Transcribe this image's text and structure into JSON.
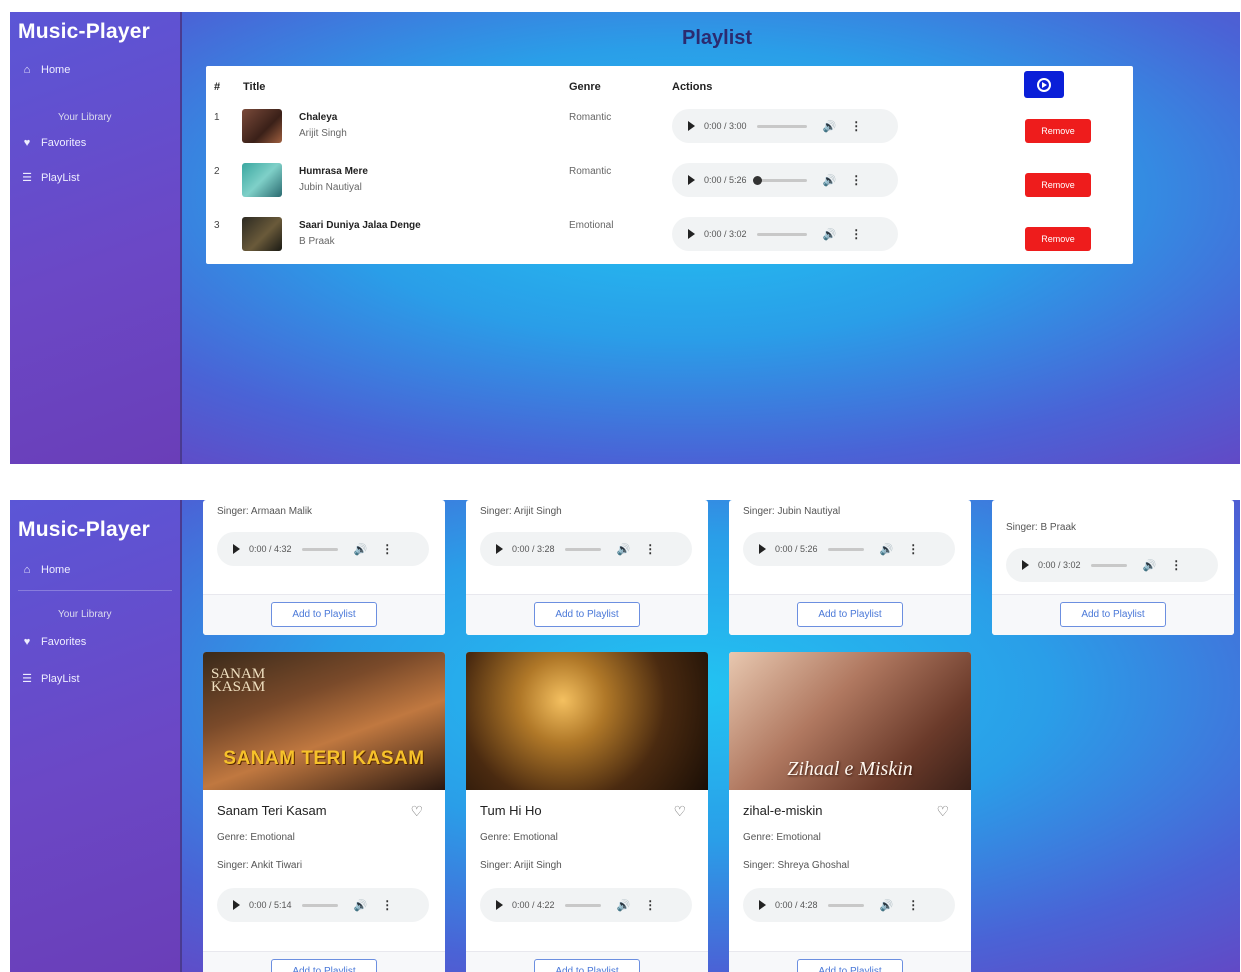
{
  "app": {
    "brand": "Music-Player",
    "nav_home": "Home",
    "library_heading": "Your Library",
    "nav_favorites": "Favorites",
    "nav_playlist": "PlayList"
  },
  "playlist": {
    "title": "Playlist",
    "columns": {
      "num": "#",
      "title": "Title",
      "genre": "Genre",
      "actions": "Actions"
    },
    "remove_label": "Remove",
    "rows": [
      {
        "num": "1",
        "song": "Chaleya",
        "artist": "Arijit Singh",
        "genre": "Romantic",
        "time": "0:00 / 3:00",
        "progress": 0.0
      },
      {
        "num": "2",
        "song": "Humrasa Mere",
        "artist": "Jubin Nautiyal",
        "genre": "Romantic",
        "time": "0:00 / 5:26",
        "progress": 0.0
      },
      {
        "num": "3",
        "song": "Saari Duniya Jalaa Denge",
        "artist": "B Praak",
        "genre": "Emotional",
        "time": "0:00 / 3:02",
        "progress": 0.0
      }
    ]
  },
  "browse": {
    "add_label": "Add to Playlist",
    "top_cards": [
      {
        "singer": "Singer: Armaan Malik",
        "time": "0:00 / 4:32"
      },
      {
        "singer": "Singer: Arijit Singh",
        "time": "0:00 / 3:28"
      },
      {
        "singer": "Singer: Jubin Nautiyal",
        "time": "0:00 / 5:26"
      },
      {
        "singer": "Singer: B Praak",
        "time": "0:00 / 3:02"
      }
    ],
    "cards": [
      {
        "title": "Sanam Teri Kasam",
        "genre": "Genre: Emotional",
        "singer": "Singer: Ankit Tiwari",
        "time": "0:00 / 5:14",
        "cover_text": "SANAM TERI KASAM",
        "cover_text_top": "SANAM KASAM"
      },
      {
        "title": "Tum Hi Ho",
        "genre": "Genre: Emotional",
        "singer": "Singer: Arijit Singh",
        "time": "0:00 / 4:22"
      },
      {
        "title": "zihal-e-miskin",
        "genre": "Genre: Emotional",
        "singer": "Singer: Shreya Ghoshal",
        "time": "0:00 / 4:28",
        "cover_text": "Zihaal e Miskin"
      }
    ]
  },
  "colors": {
    "accent_blue": "#0a1fd8",
    "remove_red": "#ee1c1c",
    "sidebar": "#6a48c6"
  }
}
